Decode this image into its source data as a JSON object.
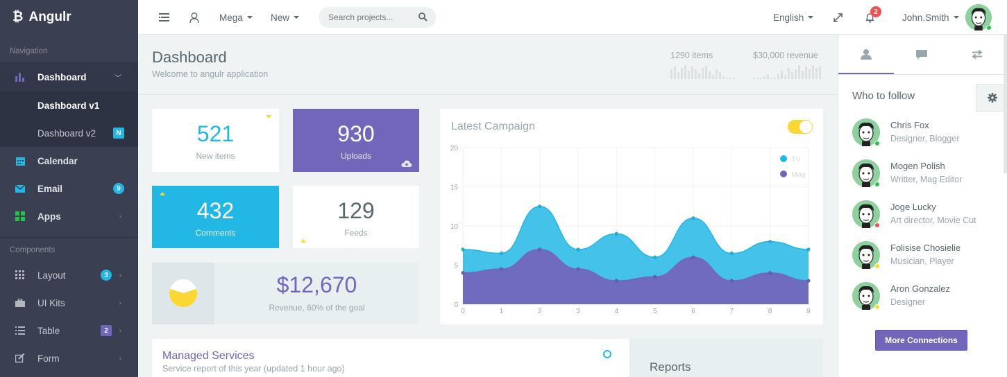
{
  "brand": {
    "name": "Angulr",
    "logo": "bitcoin-logo"
  },
  "sidebar": {
    "navigation_header": "Navigation",
    "components_header": "Components",
    "items": [
      {
        "label": "Dashboard",
        "icon": "bar-chart-icon"
      },
      {
        "label": "Dashboard v1"
      },
      {
        "label": "Dashboard v2",
        "badge": "N"
      },
      {
        "label": "Calendar",
        "icon": "calendar-icon"
      },
      {
        "label": "Email",
        "icon": "email-icon",
        "badge": "9"
      },
      {
        "label": "Apps",
        "icon": "apps-grid-icon"
      },
      {
        "label": "Layout",
        "icon": "layout-icon",
        "badge": "3"
      },
      {
        "label": "UI Kits",
        "icon": "briefcase-icon"
      },
      {
        "label": "Table",
        "icon": "list-icon",
        "badge": "2"
      },
      {
        "label": "Form",
        "icon": "edit-icon"
      }
    ]
  },
  "header": {
    "mega": "Mega",
    "new": "New",
    "search_placeholder": "Search projects...",
    "language": "English",
    "notifications": "2",
    "user": "John.Smith"
  },
  "page": {
    "title": "Dashboard",
    "subtitle": "Welcome to angulr application",
    "items_stat": "1290 items",
    "revenue_stat": "$30,000 revenue"
  },
  "tiles": {
    "new_items": {
      "value": "521",
      "label": "New items"
    },
    "uploads": {
      "value": "930",
      "label": "Uploads"
    },
    "comments": {
      "value": "432",
      "label": "Comments"
    },
    "feeds": {
      "value": "129",
      "label": "Feeds"
    },
    "revenue": {
      "value": "$12,670",
      "label": "Revenue, 60% of the goal",
      "progress": 0.6
    }
  },
  "campaign": {
    "title": "Latest Campaign",
    "toggle_on": true
  },
  "chart_data": {
    "type": "area",
    "x": [
      0,
      1,
      2,
      3,
      4,
      5,
      6,
      7,
      8,
      9
    ],
    "series": [
      {
        "name": "TV",
        "values": [
          7,
          6.5,
          12.5,
          7,
          9,
          6,
          11,
          6.5,
          8,
          7
        ],
        "color": "#23b7e5"
      },
      {
        "name": "Mag",
        "values": [
          4,
          4.5,
          7,
          4.5,
          3,
          3.5,
          6,
          3,
          4,
          3
        ],
        "color": "#7266ba"
      }
    ],
    "ylim": [
      0,
      20
    ],
    "yticks": [
      0,
      5,
      10,
      15,
      20
    ],
    "legend": "top-right",
    "grid": true
  },
  "managed": {
    "title": "Managed Services",
    "subtitle": "Service report of this year (updated 1 hour ago)"
  },
  "reports": {
    "title": "Reports"
  },
  "right_panel": {
    "follow_title": "Who to follow",
    "people": [
      {
        "name": "Chris Fox",
        "role": "Designer, Blogger",
        "status": "#27c24c"
      },
      {
        "name": "Mogen Polish",
        "role": "Writter, Mag Editor",
        "status": "#27c24c"
      },
      {
        "name": "Joge Lucky",
        "role": "Art director, Movie Cut",
        "status": "#f05050"
      },
      {
        "name": "Folisise Chosielie",
        "role": "Musician, Player",
        "status": "#fad733"
      },
      {
        "name": "Aron Gonzalez",
        "role": "Designer",
        "status": "#fad733"
      }
    ],
    "more_button": "More Connections"
  },
  "colors": {
    "primary": "#7266ba",
    "info": "#23b7e5",
    "warning": "#fad733",
    "danger": "#f05050",
    "success": "#27c24c",
    "dark": "#3a3f51"
  }
}
